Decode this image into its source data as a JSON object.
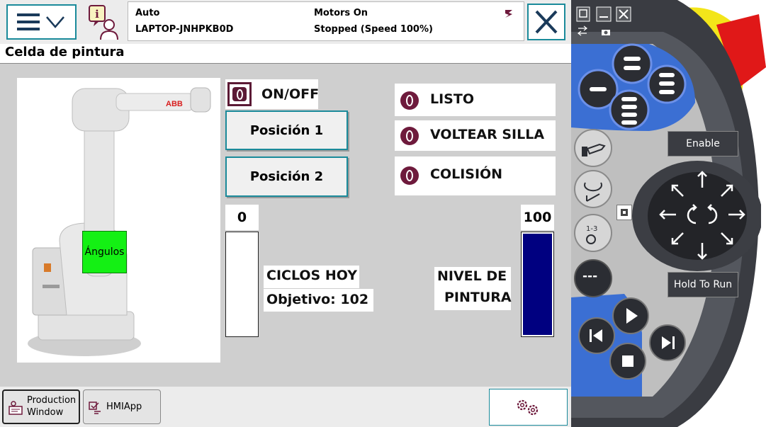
{
  "topbar": {
    "mode": "Auto",
    "hostname": "LAPTOP-JNHPKB0D",
    "motors": "Motors On",
    "state": "Stopped (Speed 100%)"
  },
  "title": "Celda de pintura",
  "controls": {
    "onoff_label": "ON/OFF",
    "position1": "Posición 1",
    "position2": "Posición 2",
    "angles": "Ángulos"
  },
  "indicators": [
    {
      "label": "LISTO"
    },
    {
      "label": "VOLTEAR SILLA"
    },
    {
      "label": "COLISIÓN"
    }
  ],
  "cycles": {
    "count": "0",
    "title": "CICLOS HOY",
    "target": "Objetivo: 102",
    "fill_fraction": 0
  },
  "paint": {
    "level": "100",
    "title_line1": "NIVEL DE",
    "title_line2": "PINTURA",
    "fill_fraction": 1.0
  },
  "taskbar": {
    "production_line1": "Production",
    "production_line2": "Window",
    "hmiapp": "HMIApp"
  },
  "pendant": {
    "enable": "Enable",
    "hold_to_run": "Hold To Run",
    "dashes": "---"
  },
  "colors": {
    "accent": "#1a8a9a",
    "lamp_off": "#6e1a3c",
    "angles_green": "#14f014",
    "paint_fill": "#000080",
    "pendant_blue": "#3b6fd3",
    "emergency_red": "#e01818",
    "pendant_yellow": "#f3e51a"
  }
}
